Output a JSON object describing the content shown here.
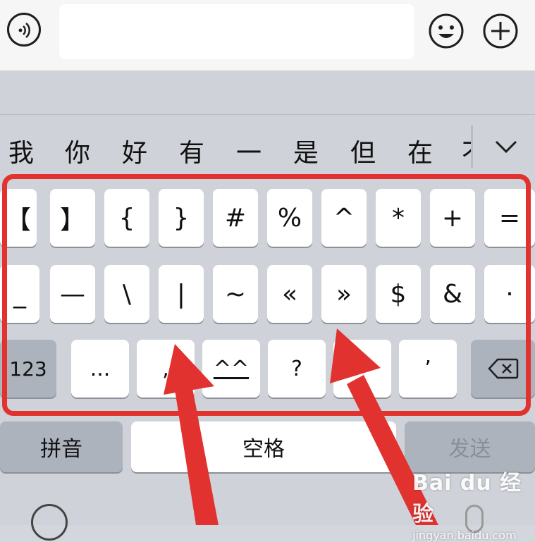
{
  "chat_input": {
    "value": ""
  },
  "candidates": [
    "我",
    "你",
    "好",
    "有",
    "一",
    "是",
    "但",
    "在",
    "不"
  ],
  "symbols_row1": [
    "【",
    "】",
    "{",
    "}",
    "#",
    "%",
    "^",
    "*",
    "+",
    "="
  ],
  "symbols_row2": [
    "_",
    "—",
    "\\",
    "|",
    "~",
    "«",
    "»",
    "$",
    "&",
    "·"
  ],
  "symbols_row3": {
    "mode": "123",
    "ellipsis": "...",
    "comma": ",",
    "emoticon": "^^",
    "question": "?",
    "blank": "",
    "apostrophe": "’"
  },
  "bottom_row": {
    "pinyin": "拼音",
    "space": "空格",
    "send": "发送"
  },
  "watermark": {
    "brand": "Bai du 经验",
    "site": "jingyan.baidu.com"
  },
  "colors": {
    "highlight_red": "#e1322f",
    "keyboard_bg": "#cfd2d9",
    "key_bg": "#ffffff",
    "dark_key_bg": "#adb3bd"
  }
}
